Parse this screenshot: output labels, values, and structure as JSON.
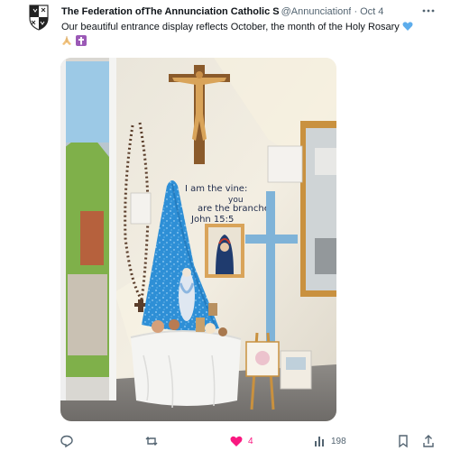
{
  "tweet": {
    "author_name": "The Federation ofThe Annunciation Catholic S",
    "handle": "@Annunciationf",
    "separator": "·",
    "date": "Oct 4",
    "text": "Our beautiful entrance display reflects October, the month of the Holy Rosary",
    "emojis": [
      "blue-heart-emoji",
      "praying-hands-emoji",
      "latin-cross-emoji"
    ],
    "photo_banner_lines": [
      "I am the vine:",
      "you",
      "are the branches",
      "John 15:5"
    ]
  },
  "actions": {
    "reply_count": "",
    "retweet_count": "",
    "like_count": "4",
    "views_count": "198"
  },
  "colors": {
    "text": "#0f1419",
    "muted": "#536471",
    "like": "#f91880"
  }
}
